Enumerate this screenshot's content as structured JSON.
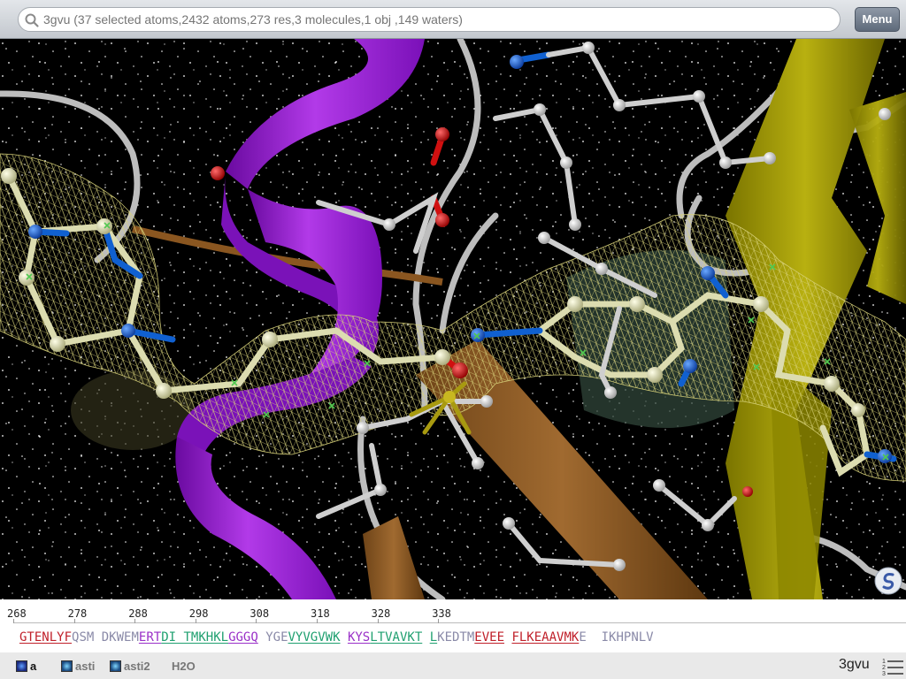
{
  "search": {
    "placeholder": "3gvu (37 selected atoms,2432 atoms,273 res,3 molecules,1 obj ,149 waters)"
  },
  "menu_button": "Menu",
  "icons": {
    "search": "search-icon",
    "logo": "app-logo",
    "list": "list-icon"
  },
  "colors": {
    "helix": "#9b1fd8",
    "strand_yellow": "#a8a000",
    "strand_orange": "#8a5620",
    "mesh": "#d8d27a",
    "nitrogen": "#1060d0",
    "oxygen": "#d01010",
    "carbon": "#dcdcb0",
    "backbone": "#c8c8c8",
    "seq_helix": "#c0202a",
    "seq_strand": "#20a070",
    "seq_turn": "#9a30c8",
    "seq_coil": "#8a8aa8"
  },
  "sequence": {
    "ticks": [
      "268",
      "278",
      "288",
      "298",
      "308",
      "318",
      "328",
      "338"
    ],
    "groups": [
      {
        "text": "GTENLYF",
        "type": "helix"
      },
      {
        "text": "QSM ",
        "type": "coil"
      },
      {
        "text": "DKWEM",
        "type": "coil"
      },
      {
        "text": "ERT",
        "type": "turn"
      },
      {
        "text": "DI ",
        "type": "strand"
      },
      {
        "text": "TMKHKL",
        "type": "strand"
      },
      {
        "text": "GGGQ",
        "type": "turn"
      },
      {
        "text": " YGE",
        "type": "coil"
      },
      {
        "text": "VYVGVWK",
        "type": "strand"
      },
      {
        "text": " ",
        "type": "coil"
      },
      {
        "text": "KYS",
        "type": "turn"
      },
      {
        "text": "LTVAVKT",
        "type": "strand"
      },
      {
        "text": " ",
        "type": "coil"
      },
      {
        "text": "L",
        "type": "strand"
      },
      {
        "text": "KEDTM",
        "type": "coil"
      },
      {
        "text": "EVEE",
        "type": "helix"
      },
      {
        "text": " ",
        "type": "coil"
      },
      {
        "text": "FLKEAAVMK",
        "type": "helix"
      },
      {
        "text": "E",
        "type": "coil"
      },
      {
        "text": "  IKHPNLV",
        "type": "coil"
      }
    ]
  },
  "objects": [
    {
      "label": "a",
      "active": true
    },
    {
      "label": "asti",
      "active": false
    },
    {
      "label": "asti2",
      "active": false
    },
    {
      "label": "H2O",
      "active": false
    }
  ],
  "object_name": "3gvu"
}
